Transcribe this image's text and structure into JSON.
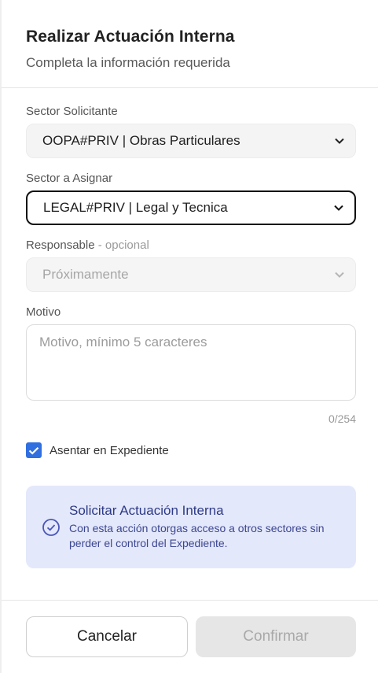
{
  "dialog": {
    "title": "Realizar Actuación Interna",
    "subtitle": "Completa la información requerida"
  },
  "form": {
    "sector_solicitante": {
      "label": "Sector Solicitante",
      "value": "OOPA#PRIV | Obras Particulares"
    },
    "sector_asignar": {
      "label": "Sector a Asignar",
      "value": "LEGAL#PRIV | Legal y Tecnica"
    },
    "responsable": {
      "label": "Responsable",
      "optional_suffix": "- opcional",
      "value": "Próximamente"
    },
    "motivo": {
      "label": "Motivo",
      "placeholder": "Motivo, mínimo 5 caracteres",
      "value": "",
      "counter": "0/254"
    },
    "asentar": {
      "label": "Asentar en Expediente",
      "checked": true
    }
  },
  "info_box": {
    "title": "Solicitar Actuación Interna",
    "body": "Con esta acción otorgas acceso a otros sectores sin perder el control del Expediente.",
    "icon": "check-circle-icon"
  },
  "actions": {
    "cancel_label": "Cancelar",
    "confirm_label": "Confirmar"
  },
  "colors": {
    "checkbox": "#2f6fe0",
    "info_bg": "#e4e8fb",
    "info_text": "#2d3a86"
  }
}
